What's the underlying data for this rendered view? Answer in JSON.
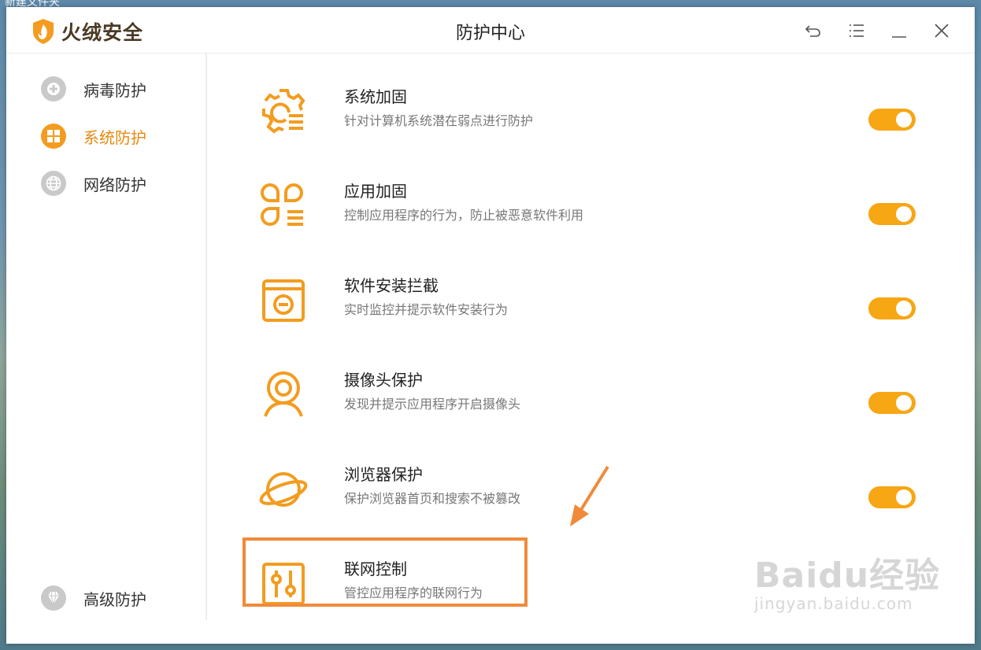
{
  "desktop": {
    "folder_label": "新建文件夹"
  },
  "app": {
    "brand": "火绒安全",
    "window_title": "防护中心",
    "window_controls": [
      {
        "name": "back-icon"
      },
      {
        "name": "menu-icon"
      },
      {
        "name": "minimize-icon"
      },
      {
        "name": "close-icon"
      }
    ]
  },
  "sidebar": {
    "items": [
      {
        "label": "病毒防护",
        "icon": "virus-shield-icon",
        "active": false
      },
      {
        "label": "系统防护",
        "icon": "windows-icon",
        "active": true
      },
      {
        "label": "网络防护",
        "icon": "globe-icon",
        "active": false
      },
      {
        "label": "高级防护",
        "icon": "diamond-icon",
        "active": false
      }
    ]
  },
  "features": [
    {
      "title": "系统加固",
      "desc": "针对计算机系统潜在弱点进行防护",
      "icon": "gear-list-icon",
      "enabled": true
    },
    {
      "title": "应用加固",
      "desc": "控制应用程序的行为，防止被恶意软件利用",
      "icon": "app-grid-icon",
      "enabled": true
    },
    {
      "title": "软件安装拦截",
      "desc": "实时监控并提示软件安装行为",
      "icon": "install-block-icon",
      "enabled": true
    },
    {
      "title": "摄像头保护",
      "desc": "发现并提示应用程序开启摄像头",
      "icon": "webcam-icon",
      "enabled": true
    },
    {
      "title": "浏览器保护",
      "desc": "保护浏览器首页和搜索不被篡改",
      "icon": "planet-icon",
      "enabled": true
    },
    {
      "title": "联网控制",
      "desc": "管控应用程序的联网行为",
      "icon": "sliders-icon",
      "enabled": null
    }
  ],
  "annotation": {
    "arrow_color": "#f08a3a",
    "highlight_color": "#f08a3a"
  },
  "watermark": {
    "main": "Baidu经验",
    "sub": "jingyan.baidu.com"
  },
  "colors": {
    "accent": "#f39c1f",
    "toggle_on": "#f7a614",
    "inactive_icon": "#c9c9c9"
  }
}
